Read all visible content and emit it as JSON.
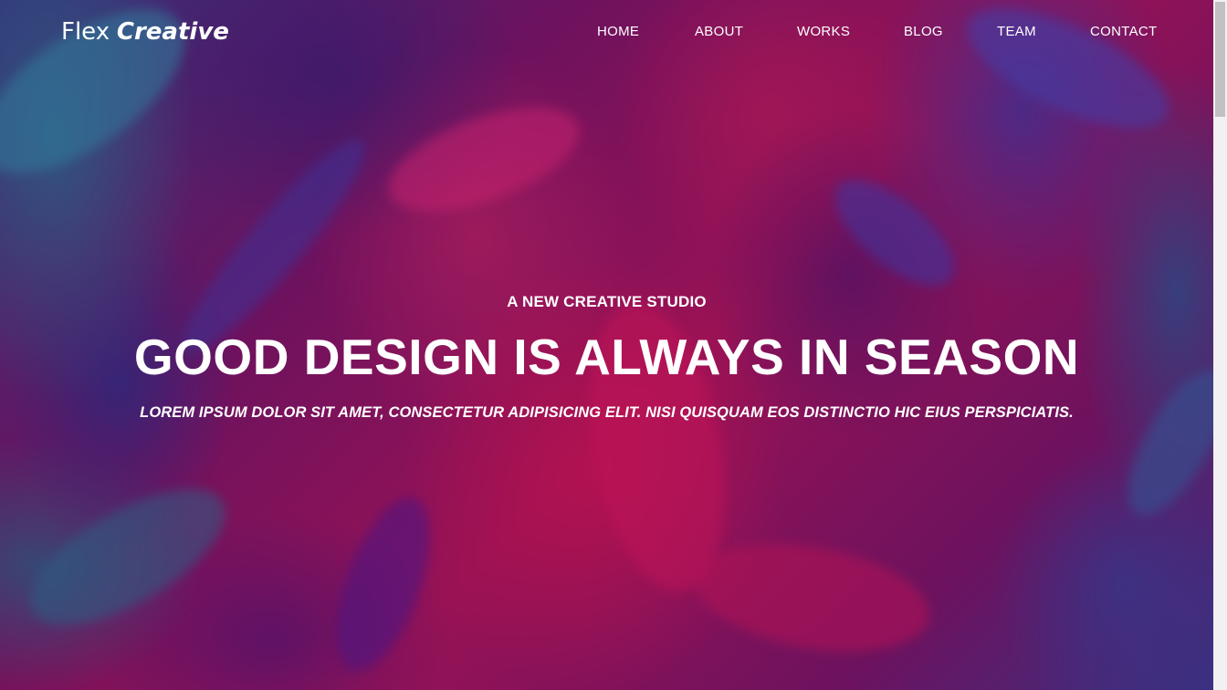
{
  "brand": {
    "name_light": "Flex",
    "name_bold": "Creative"
  },
  "nav": {
    "items": [
      {
        "label": "HOME"
      },
      {
        "label": "ABOUT"
      },
      {
        "label": "WORKS"
      },
      {
        "label": "BLOG"
      },
      {
        "label": "TEAM"
      },
      {
        "label": "CONTACT"
      }
    ]
  },
  "hero": {
    "eyebrow": "A NEW CREATIVE STUDIO",
    "headline": "GOOD DESIGN IS ALWAYS IN SEASON",
    "subline": "LOREM IPSUM DOLOR SIT AMET, CONSECTETUR ADIPISICING ELIT. NISI QUISQUAM EOS DISTINCTIO HIC EIUS PERSPICIATIS."
  },
  "colors": {
    "text": "#ffffff",
    "magenta": "#a3145a",
    "blue": "#1d3e8a",
    "teal": "#1478a0"
  }
}
